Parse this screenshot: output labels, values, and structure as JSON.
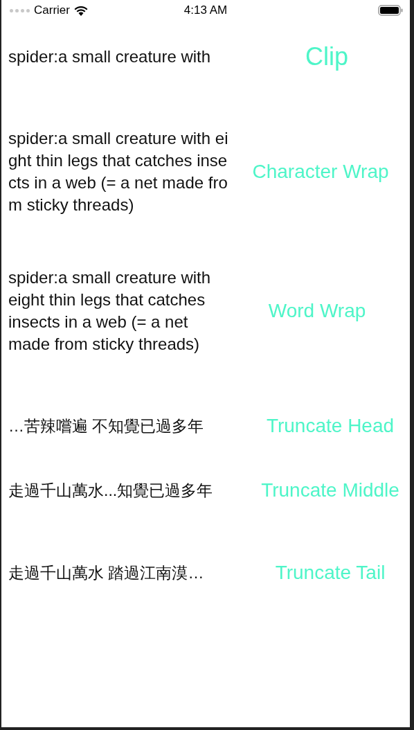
{
  "status_bar": {
    "carrier": "Carrier",
    "time": "4:13 AM"
  },
  "rows": [
    {
      "text": "spider:a small creature with",
      "label": "Clip",
      "kind": "clip"
    },
    {
      "text": "spider:a small creature with eight thin legs that catches insects in a web (= a net made from sticky threads)",
      "label": "Character Wrap",
      "kind": "char"
    },
    {
      "text": "spider:a small creature with eight thin legs that catches insects in a web (= a net made from sticky threads)",
      "label": "Word Wrap",
      "kind": "word"
    },
    {
      "text": "…苦辣嚐遍 不知覺已過多年",
      "label": "Truncate Head",
      "kind": "line"
    },
    {
      "text": "走過千山萬水...知覺已過多年",
      "label": "Truncate Middle",
      "kind": "line"
    },
    {
      "text": "走過千山萬水 踏過江南漠…",
      "label": "Truncate Tail",
      "kind": "line"
    }
  ]
}
